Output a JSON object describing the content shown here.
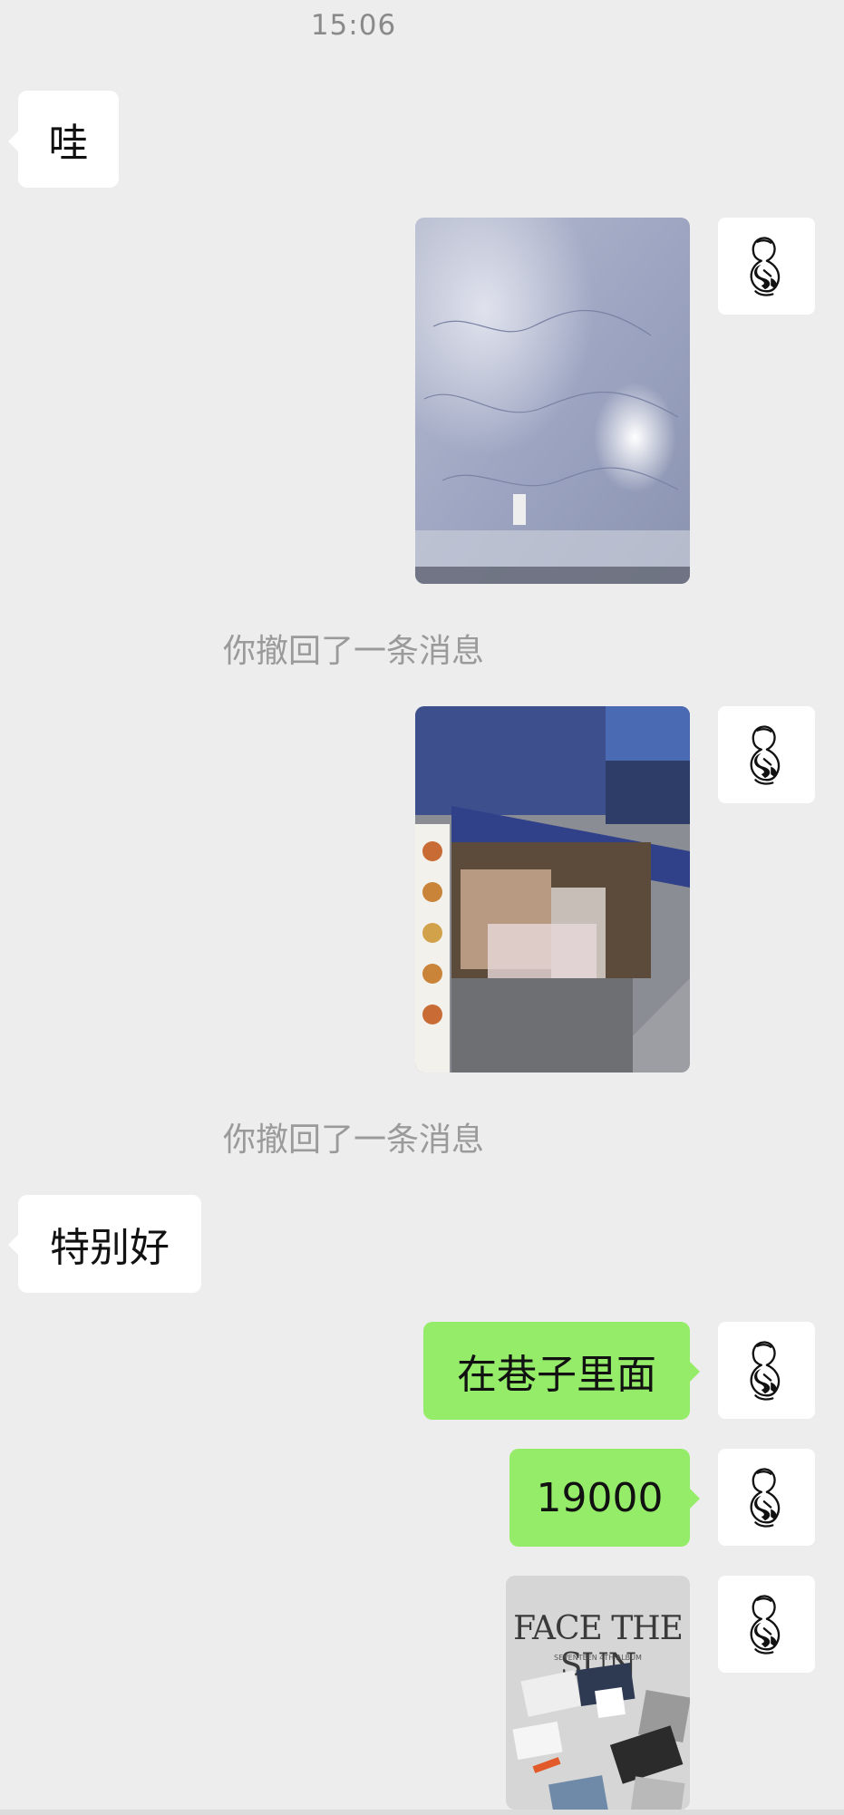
{
  "timestamp": "15:06",
  "messages": {
    "m1": "哇",
    "recall1": "你撤回了一条消息",
    "recall2": "你撤回了一条消息",
    "m2": "特别好",
    "m3": "在巷子里面",
    "m4": "19000"
  },
  "images": {
    "poster_title": "FACE THE SUN",
    "poster_subtitle": "SEVENTEEN 4TH ALBUM"
  },
  "colors": {
    "background": "#ededed",
    "incoming_bubble": "#ffffff",
    "outgoing_bubble": "#95ec69",
    "system_text": "#9a9a9a"
  },
  "icons": {
    "avatar": "sketch-figure-avatar-icon"
  }
}
